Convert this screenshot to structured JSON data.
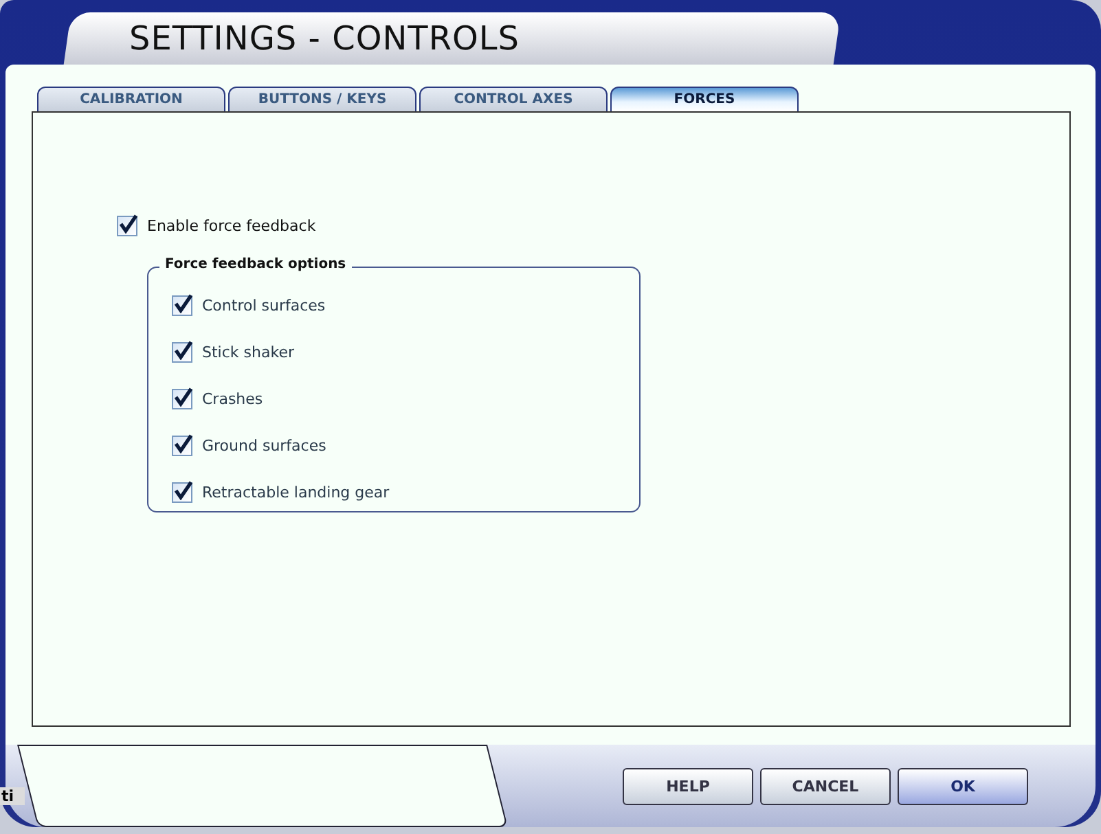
{
  "window": {
    "title": "SETTINGS - CONTROLS"
  },
  "tabs": [
    {
      "label": "CALIBRATION",
      "selected": false
    },
    {
      "label": "BUTTONS / KEYS",
      "selected": false
    },
    {
      "label": "CONTROL AXES",
      "selected": false
    },
    {
      "label": "FORCES",
      "selected": true
    }
  ],
  "enable_force_feedback": {
    "label": "Enable force feedback",
    "checked": true
  },
  "options_group": {
    "title": "Force feedback options",
    "items": [
      {
        "label": "Control surfaces",
        "checked": true
      },
      {
        "label": "Stick shaker",
        "checked": true
      },
      {
        "label": "Crashes",
        "checked": true
      },
      {
        "label": "Ground surfaces",
        "checked": true
      },
      {
        "label": "Retractable landing gear",
        "checked": true
      }
    ]
  },
  "buttons": [
    {
      "label": "HELP",
      "default": false
    },
    {
      "label": "CANCEL",
      "default": false
    },
    {
      "label": "OK",
      "default": true
    }
  ],
  "background_window": {
    "text": "ti"
  }
}
